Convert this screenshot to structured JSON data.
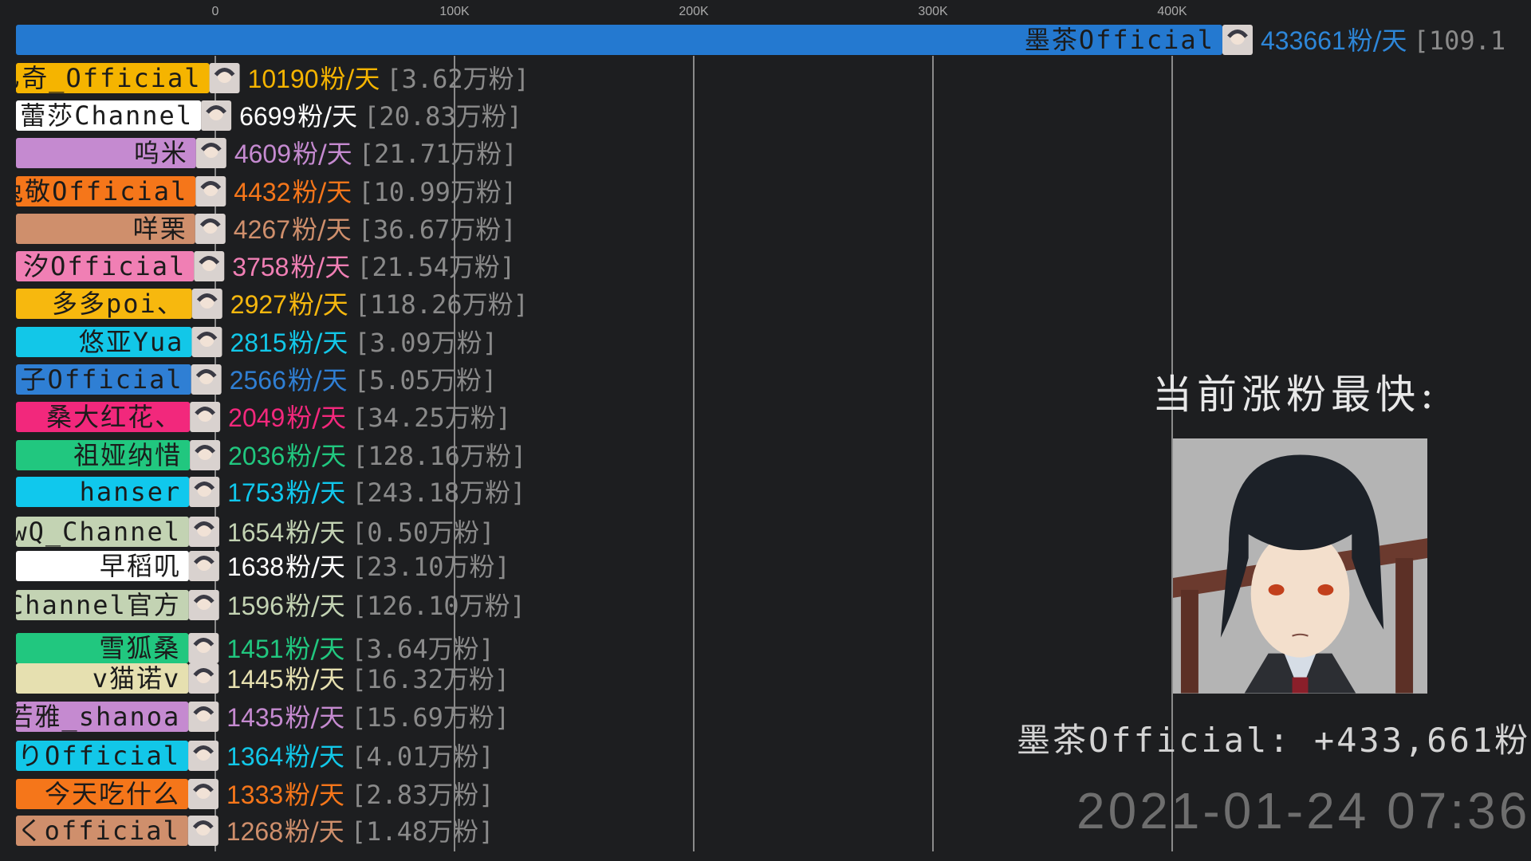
{
  "chart_data": {
    "type": "bar",
    "orientation": "horizontal",
    "title": "",
    "xlabel": "",
    "ylabel": "",
    "x_axis_position": "top",
    "xlim": [
      0,
      433661
    ],
    "x_ticks": [
      {
        "value": 0,
        "label": "0"
      },
      {
        "value": 100000,
        "label": "100K"
      },
      {
        "value": 200000,
        "label": "200K"
      },
      {
        "value": 300000,
        "label": "300K"
      },
      {
        "value": 400000,
        "label": "400K"
      }
    ],
    "grid": true,
    "value_suffix": "粉/天",
    "bars": [
      {
        "name": "墨茶Official",
        "value": 433661,
        "total": "[109.1",
        "color": "#2479d0",
        "value_color": "#2d86d8"
      },
      {
        "name": "乙奇_Official",
        "value": 10190,
        "total": "[3.62万粉]",
        "color": "#f5b400",
        "value_color": "#f5b400"
      },
      {
        "name": "蕾莎Channel",
        "value": 6699,
        "total": "[20.83万粉]",
        "color": "#ffffff",
        "value_color": "#ffffff"
      },
      {
        "name": "呜米",
        "value": 4609,
        "total": "[21.71万粉]",
        "color": "#c58ad0",
        "value_color": "#c58ad0"
      },
      {
        "name": "兔敬Official",
        "value": 4432,
        "total": "[10.99万粉]",
        "color": "#f5761a",
        "value_color": "#f5761a"
      },
      {
        "name": "咩栗",
        "value": 4267,
        "total": "[36.67万粉]",
        "color": "#cf8f6c",
        "value_color": "#cf8f6c"
      },
      {
        "name": "汐Official",
        "value": 3758,
        "total": "[21.54万粉]",
        "color": "#f07fb4",
        "value_color": "#f07fb4"
      },
      {
        "name": "多多poi、",
        "value": 2927,
        "total": "[118.26万粉]",
        "color": "#f7b80e",
        "value_color": "#f7b80e"
      },
      {
        "name": "悠亚Yua",
        "value": 2815,
        "total": "[3.09万粉]",
        "color": "#12c7e8",
        "value_color": "#12c7e8"
      },
      {
        "name": "子Official",
        "value": 2566,
        "total": "[5.05万粉]",
        "color": "#2f7fd4",
        "value_color": "#2f7fd4"
      },
      {
        "name": "桑大红花、",
        "value": 2049,
        "total": "[34.25万粉]",
        "color": "#f2287c",
        "value_color": "#f2287c"
      },
      {
        "name": "祖娅纳惜",
        "value": 2036,
        "total": "[128.16万粉]",
        "color": "#21c77f",
        "value_color": "#21c77f"
      },
      {
        "name": "hanser",
        "value": 1753,
        "total": "[243.18万粉]",
        "color": "#10c8ed",
        "value_color": "#10c8ed"
      },
      {
        "name": "QwQ_Channel",
        "value": 1654,
        "total": "[0.50万粉]",
        "color": "#c3d3b3",
        "value_color": "#c3d3b3"
      },
      {
        "name": "早稻叽",
        "value": 1638,
        "total": "[23.10万粉]",
        "color": "#ffffff",
        "value_color": "#ffffff"
      },
      {
        "name": "Channel官方",
        "value": 1596,
        "total": "[126.10万粉]",
        "color": "#c3d3b3",
        "value_color": "#c3d3b3"
      },
      {
        "name": "雪狐桑",
        "value": 1451,
        "total": "[3.64万粉]",
        "color": "#21c77f",
        "value_color": "#21c77f"
      },
      {
        "name": "v猫诺v",
        "value": 1445,
        "total": "[16.32万粉]",
        "color": "#e6e0b0",
        "value_color": "#e6e0b0"
      },
      {
        "name": "若雅_shanoa",
        "value": 1435,
        "total": "[15.69万粉]",
        "color": "#c58ad0",
        "value_color": "#c58ad0"
      },
      {
        "name": "りOfficial",
        "value": 1364,
        "total": "[4.01万粉]",
        "color": "#12c7e8",
        "value_color": "#12c7e8"
      },
      {
        "name": "今天吃什么",
        "value": 1333,
        "total": "[2.83万粉]",
        "color": "#f5761a",
        "value_color": "#f5761a"
      },
      {
        "name": "くofficial",
        "value": 1268,
        "total": "[1.48万粉]",
        "color": "#cf8f6c",
        "value_color": "#cf8f6c"
      }
    ]
  },
  "side_panel": {
    "title": "当前涨粉最快:",
    "leader_text": "墨茶Official: +433,661粉",
    "timestamp": "2021-01-24 07:36"
  }
}
